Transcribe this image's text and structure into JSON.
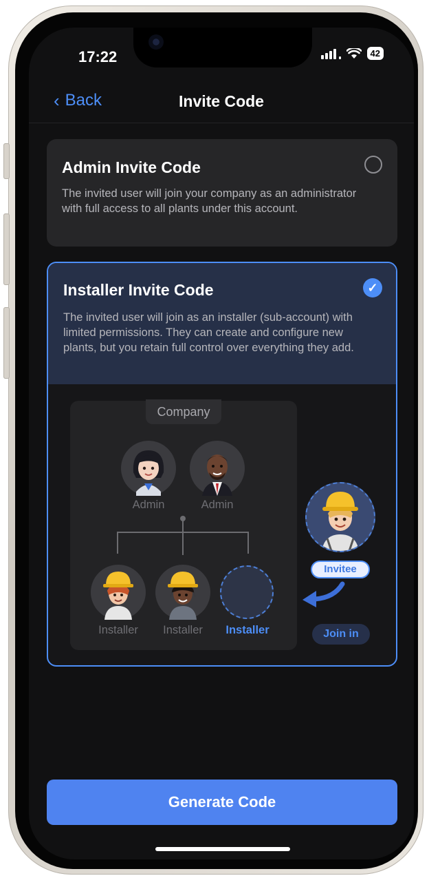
{
  "status": {
    "time": "17:22",
    "battery": "42"
  },
  "nav": {
    "back_label": "Back",
    "title": "Invite Code"
  },
  "options": {
    "admin": {
      "title": "Admin Invite Code",
      "description": "The invited user will join your company as an administrator with full access to all plants under this account.",
      "selected": false
    },
    "installer": {
      "title": "Installer Invite Code",
      "description": "The invited user will join as an installer (sub-account) with limited permissions. They can create and configure new plants, but you retain full control over everything they add.",
      "selected": true
    }
  },
  "diagram": {
    "company_label": "Company",
    "admins": [
      "Admin",
      "Admin"
    ],
    "installers": [
      "Installer",
      "Installer",
      "Installer"
    ],
    "invitee_label": "Invitee",
    "join_label": "Join in"
  },
  "footer": {
    "generate_label": "Generate Code"
  },
  "colors": {
    "accent": "#4d8ef7",
    "background": "#111112",
    "card": "#262628"
  }
}
